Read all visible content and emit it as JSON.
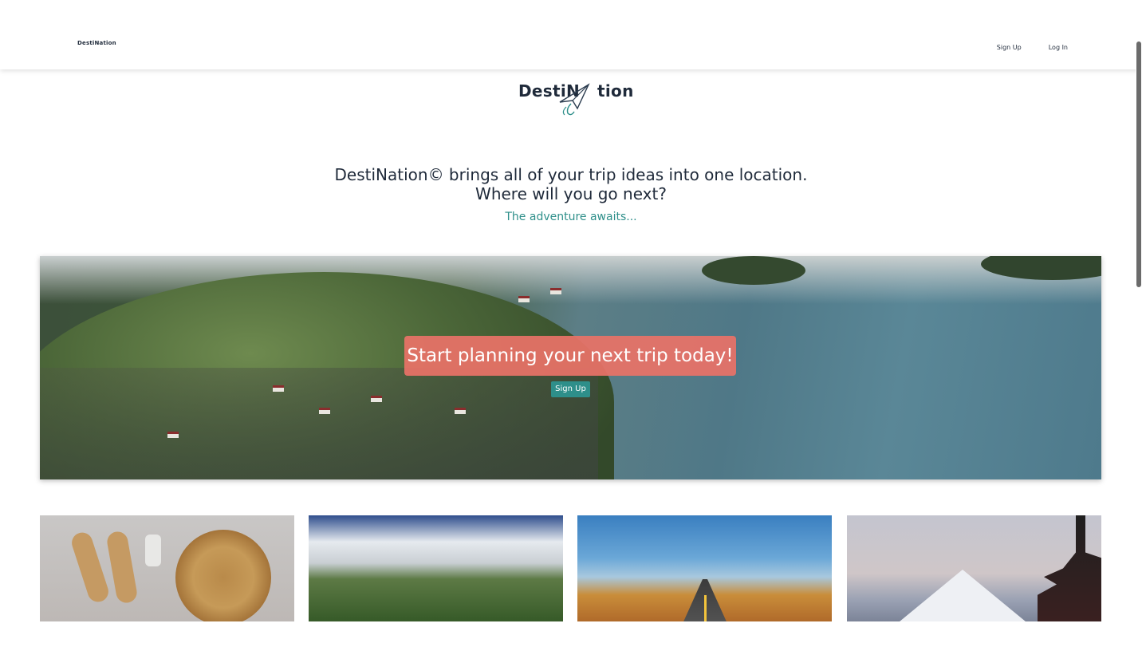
{
  "nav": {
    "logo_text": "DestiNation",
    "links": [
      "Sign Up",
      "Log In"
    ]
  },
  "brand": {
    "left": "DestiN",
    "right": "tion"
  },
  "intro": {
    "line1": "DestiNation© brings all of your trip ideas into one location.",
    "line2": "Where will you go next?",
    "subtitle": "The adventure awaits..."
  },
  "hero": {
    "headline": "Start planning your next trip today!",
    "button_label": "Sign Up"
  },
  "colors": {
    "accent": "#2e8f8a",
    "cta": "#e87267",
    "text": "#1f2a3a"
  },
  "icons": {
    "brand": "paper-plane-icon"
  }
}
